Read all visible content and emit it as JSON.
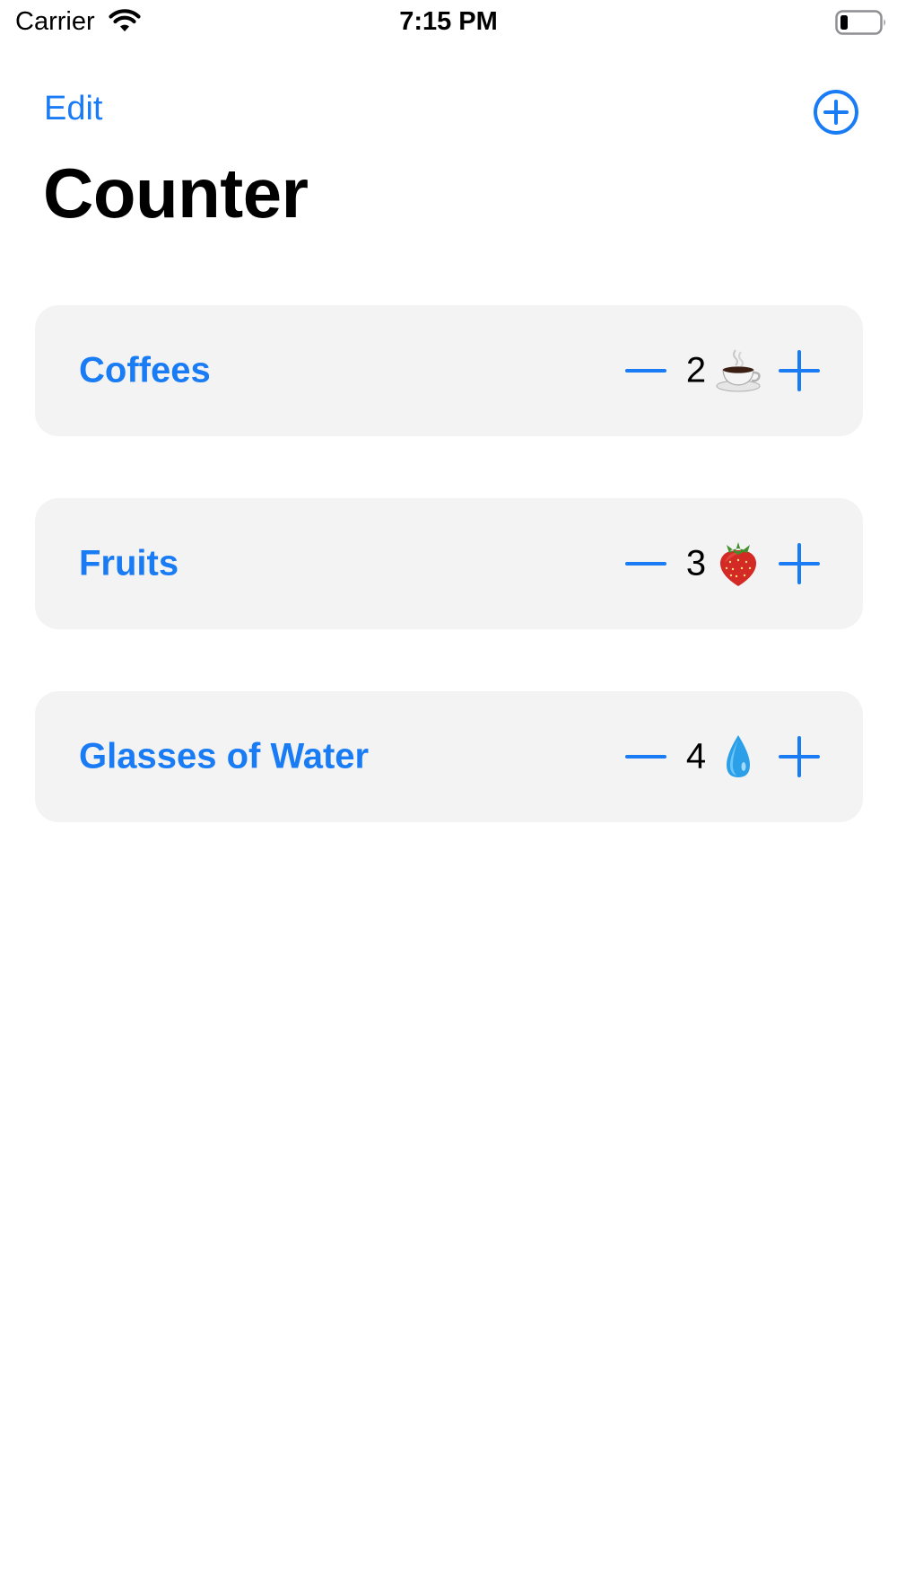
{
  "status_bar": {
    "carrier": "Carrier",
    "time": "7:15 PM",
    "wifi_icon": "wifi-icon",
    "battery_icon": "battery-low-icon"
  },
  "nav": {
    "edit_label": "Edit",
    "add_icon": "plus-circle-icon",
    "title": "Counter"
  },
  "counters": [
    {
      "label": "Coffees",
      "count": "2",
      "emoji": "coffee-cup-icon"
    },
    {
      "label": "Fruits",
      "count": "3",
      "emoji": "strawberry-icon"
    },
    {
      "label": "Glasses of Water",
      "count": "4",
      "emoji": "water-drop-icon"
    }
  ],
  "colors": {
    "accent": "#1a7cf5",
    "card_background": "#f3f3f4",
    "text": "#000000"
  }
}
